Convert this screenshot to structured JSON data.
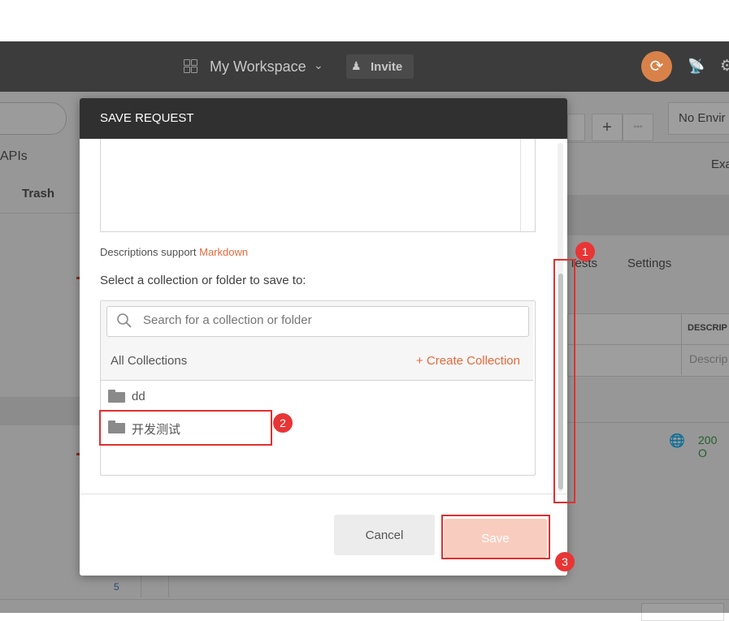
{
  "header": {
    "workspace_label": "My Workspace",
    "invite_label": "Invite"
  },
  "background": {
    "apis_label": "APIs",
    "trash_label": "Trash",
    "environment_label": "No Envir",
    "examples_label": "Exa",
    "tabs_tests": "Tests",
    "tabs_settings": "Settings",
    "table_header_description": "DESCRIP",
    "table_cell_description": "Descrip",
    "status_text": "200 O",
    "line_number": "5"
  },
  "dialog": {
    "title": "SAVE REQUEST",
    "markdown_hint_prefix": "Descriptions support ",
    "markdown_link": "Markdown",
    "select_label": "Select a collection or folder to save to:",
    "search_placeholder": "Search for a collection or folder",
    "all_collections_label": "All Collections",
    "create_collection_label": "+ Create Collection",
    "folders": [
      "dd",
      "开发测试"
    ],
    "cancel_label": "Cancel",
    "save_label": "Save"
  },
  "annotations": [
    "1",
    "2",
    "3"
  ],
  "colors": {
    "accent": "#e46a3b",
    "topbar": "#3c3c3c",
    "dialog_header": "#303030",
    "save_button_disabled": "#f8cdbf",
    "annotation_red": "#e03030"
  }
}
